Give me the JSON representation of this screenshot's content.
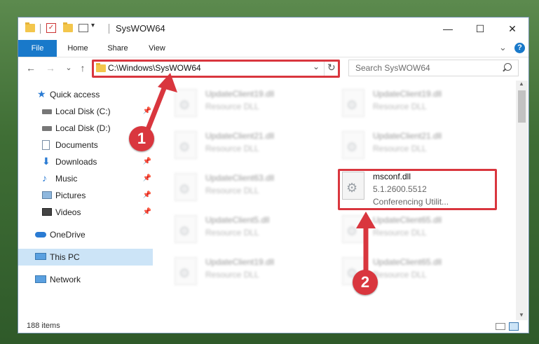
{
  "window": {
    "title": "SysWOW64",
    "minimize": "—",
    "maximize": "☐",
    "close": "✕"
  },
  "ribbon": {
    "tabs": [
      "File",
      "Home",
      "Share",
      "View"
    ],
    "expand": "⌄",
    "help": "?"
  },
  "nav": {
    "back": "←",
    "forward": "→",
    "recent": "⌄",
    "up": "↑",
    "address": "C:\\Windows\\SysWOW64",
    "dropdown": "⌄",
    "refresh": "↻",
    "search_placeholder": "Search SysWOW64"
  },
  "sidebar": {
    "items": [
      {
        "label": "Quick access",
        "icon": "star-icon"
      },
      {
        "label": "Local Disk (C:)",
        "icon": "drive-icon"
      },
      {
        "label": "Local Disk (D:)",
        "icon": "drive-icon"
      },
      {
        "label": "Documents",
        "icon": "documents-icon"
      },
      {
        "label": "Downloads",
        "icon": "download-icon"
      },
      {
        "label": "Music",
        "icon": "music-icon"
      },
      {
        "label": "Pictures",
        "icon": "pictures-icon"
      },
      {
        "label": "Videos",
        "icon": "videos-icon"
      },
      {
        "label": "OneDrive",
        "icon": "cloud-icon"
      },
      {
        "label": "This PC",
        "icon": "computer-icon"
      },
      {
        "label": "Network",
        "icon": "network-icon"
      }
    ]
  },
  "files": {
    "left": [
      {
        "name": "UpdateClient19.dll",
        "type": "Resource DLL"
      },
      {
        "name": "UpdateClient21.dll",
        "type": "Resource DLL"
      },
      {
        "name": "UpdateClient63.dll",
        "type": "Resource DLL"
      },
      {
        "name": "UpdateClient5.dll",
        "type": "Resource DLL"
      },
      {
        "name": "UpdateClient19.dll",
        "type": "Resource DLL"
      }
    ],
    "right": [
      {
        "name": "UpdateClient19.dll",
        "type": "Resource DLL"
      },
      {
        "name": "UpdateClient21.dll",
        "type": "Resource DLL"
      },
      {
        "name": "UpdateClient65.dll",
        "type": "Resource DLL"
      },
      {
        "name": "UpdateClient65.dll",
        "type": "Resource DLL"
      }
    ],
    "highlight": {
      "name": "msconf.dll",
      "version": "5.1.2600.5512",
      "description": "Conferencing Utilit..."
    }
  },
  "status": {
    "count": "188 items"
  },
  "annotations": {
    "step1": "1",
    "step2": "2",
    "accent": "#d9363e"
  }
}
